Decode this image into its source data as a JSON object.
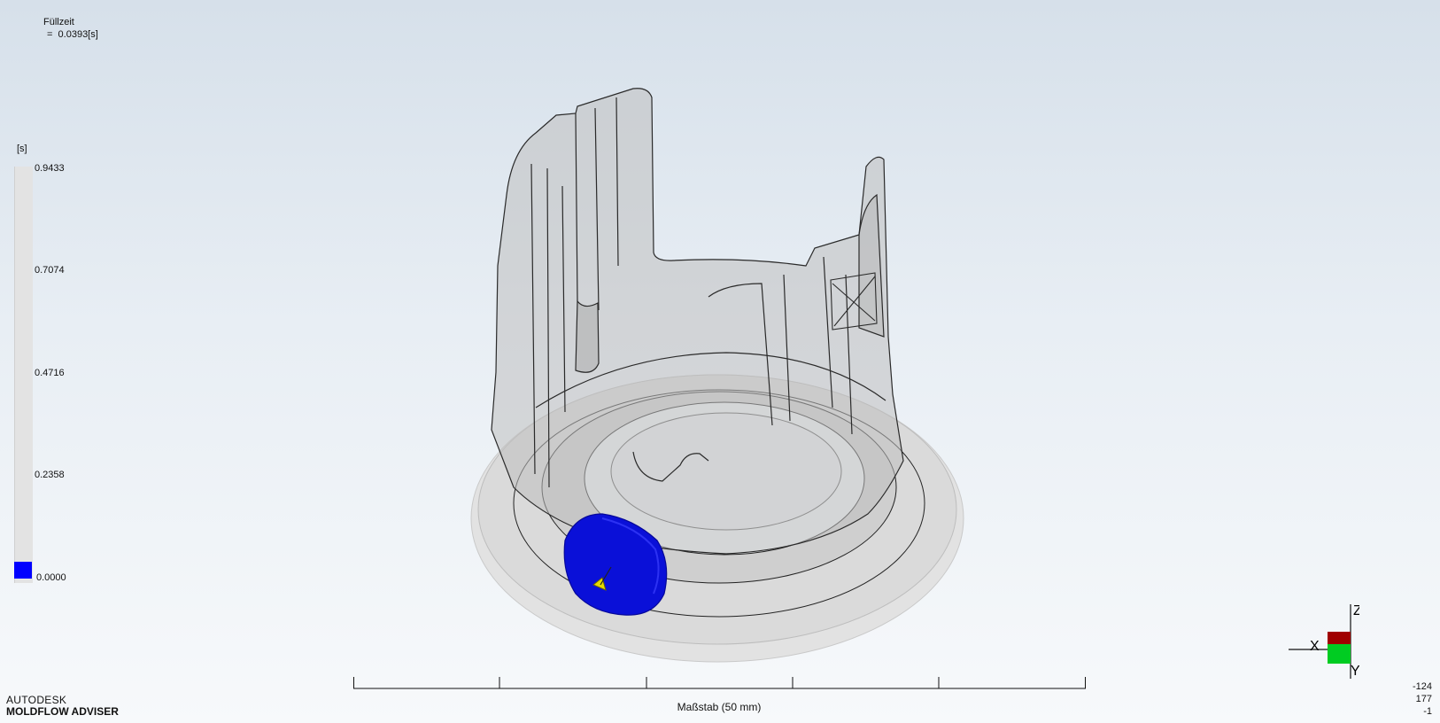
{
  "result": {
    "title": "Füllzeit",
    "value_line": "=  0.0393[s]"
  },
  "legend": {
    "unit": "[s]",
    "ticks": [
      "0.9433",
      "0.7074",
      "0.4716",
      "0.2358",
      "0.0000"
    ],
    "bar_color": "#e3e3e3",
    "min_color": "#0000ff"
  },
  "scale": {
    "label": "Maßstab (50 mm)"
  },
  "axes": {
    "z_label": "Z",
    "x_label": "X",
    "y_label": "Y"
  },
  "brand": {
    "company": "AUTODESK",
    "product": "MOLDFLOW ADVISER"
  },
  "coordinates": [
    "-124",
    "177",
    "-1"
  ],
  "colors": {
    "fill_front": "#0a10d8",
    "injection_marker": "#e6d800"
  }
}
